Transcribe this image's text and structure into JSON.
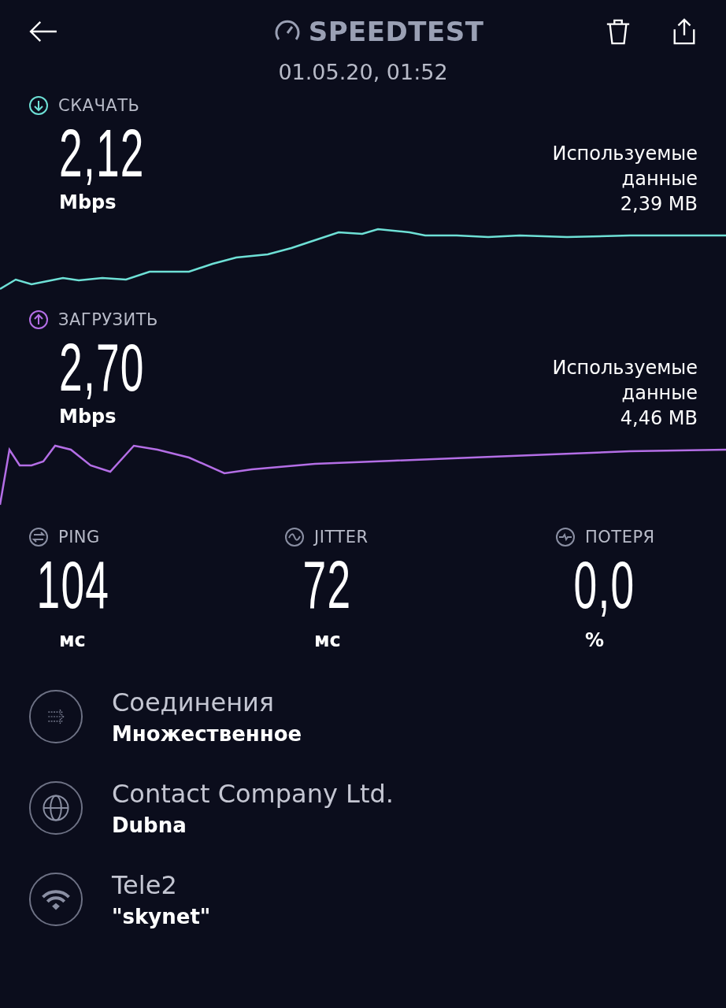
{
  "header": {
    "title": "SPEEDTEST",
    "date": "01.05.20, 01:52"
  },
  "tests": [
    {
      "kind": "download",
      "label": "СКАЧАТЬ",
      "value": "2,12",
      "unit": "Mbps",
      "data_label": "Используемые данные",
      "data_value": "2,39 MB",
      "color": "#6ee0d6"
    },
    {
      "kind": "upload",
      "label": "ЗАГРУЗИТЬ",
      "value": "2,70",
      "unit": "Mbps",
      "data_label": "Используемые данные",
      "data_value": "4,46 MB",
      "color": "#b46ee6"
    }
  ],
  "stats": [
    {
      "kind": "ping",
      "label": "PING",
      "value": "104",
      "unit": "мс"
    },
    {
      "kind": "jitter",
      "label": "JITTER",
      "value": "72",
      "unit": "мс"
    },
    {
      "kind": "loss",
      "label": "ПОТЕРЯ",
      "value": "0,0",
      "unit": "%"
    }
  ],
  "info": [
    {
      "kind": "connections",
      "title": "Соединения",
      "value": "Множественное"
    },
    {
      "kind": "server",
      "title": "Contact Company Ltd.",
      "value": "Dubna"
    },
    {
      "kind": "network",
      "title": "Tele2",
      "value": "\"skynet\""
    }
  ]
}
